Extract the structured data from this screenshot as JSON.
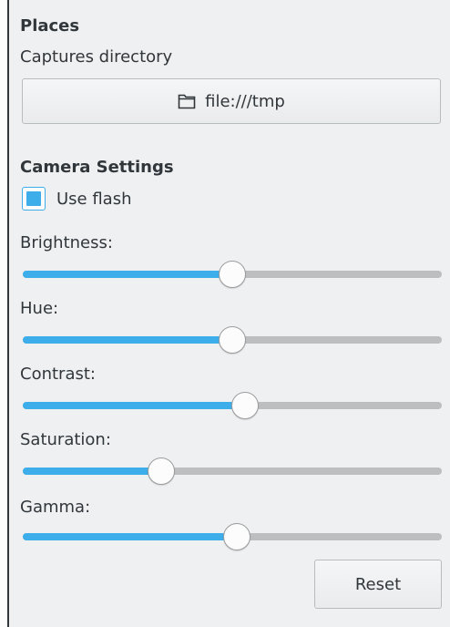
{
  "places": {
    "title": "Places",
    "captures_label": "Captures directory",
    "directory_button_label": "file:///tmp",
    "directory_icon": "folder-icon"
  },
  "camera": {
    "title": "Camera Settings",
    "use_flash": {
      "label": "Use flash",
      "checked": true
    },
    "sliders": [
      {
        "label": "Brightness:",
        "value": 0.5
      },
      {
        "label": "Hue:",
        "value": 0.5
      },
      {
        "label": "Contrast:",
        "value": 0.53
      },
      {
        "label": "Saturation:",
        "value": 0.33
      },
      {
        "label": "Gamma:",
        "value": 0.51
      }
    ],
    "reset_label": "Reset"
  },
  "colors": {
    "accent": "#3daee9",
    "background": "#eff0f1",
    "text": "#31363b",
    "track": "#bdbebf"
  }
}
